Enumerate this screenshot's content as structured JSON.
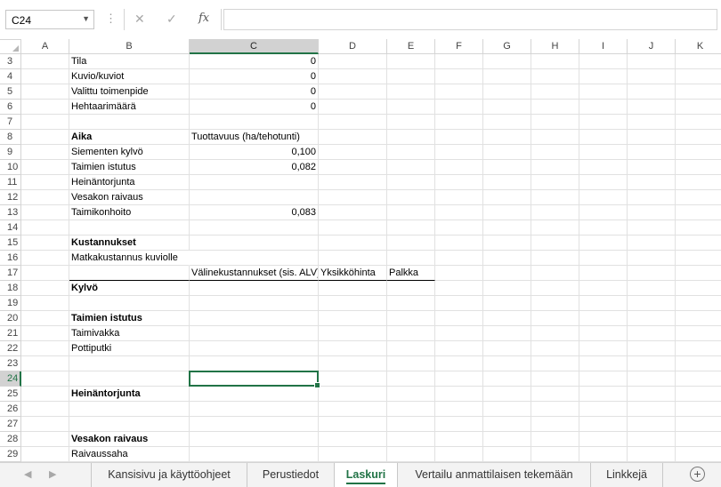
{
  "formula_bar": {
    "name_box": "C24",
    "cancel_icon": "✕",
    "enter_icon": "✓",
    "fx_label": "fx",
    "formula": ""
  },
  "columns": [
    "A",
    "B",
    "C",
    "D",
    "E",
    "F",
    "G",
    "H",
    "I",
    "J",
    "K"
  ],
  "selected_column": "C",
  "selected_row": "24",
  "rows": [
    "3",
    "4",
    "5",
    "6",
    "7",
    "8",
    "9",
    "10",
    "11",
    "12",
    "13",
    "14",
    "15",
    "16",
    "17",
    "18",
    "19",
    "20",
    "21",
    "22",
    "23",
    "24",
    "25",
    "26",
    "27",
    "28",
    "29"
  ],
  "cells": {
    "B3": "Tila",
    "C3": "0",
    "B4": "Kuvio/kuviot",
    "C4": "0",
    "B5": "Valittu toimenpide",
    "C5": "0",
    "B6": "Hehtaarimäärä",
    "C6": "0",
    "B8": "Aika",
    "C8": "Tuottavuus (ha/tehotunti)",
    "B9": "Siementen kylvö",
    "C9": "0,100",
    "B10": "Taimien istutus",
    "C10": "0,082",
    "B11": "Heinäntorjunta",
    "B12": "Vesakon raivaus",
    "B13": "Taimikonhoito",
    "C13": "0,083",
    "B15": "Kustannukset",
    "B16": "Matkakustannus kuviolle",
    "C17": "Välinekustannukset (sis. ALV)",
    "D17": "Yksikköhinta",
    "E17": "Palkka",
    "B18": "Kylvö",
    "B20": "Taimien istutus",
    "B21": "Taimivakka",
    "B22": "Pottiputki",
    "B25": "Heinäntorjunta",
    "B28": "Vesakon raivaus",
    "B29": "Raivaussaha"
  },
  "sheet_tabs": [
    {
      "label": "Kansisivu ja käyttöohjeet",
      "active": false
    },
    {
      "label": "Perustiedot",
      "active": false
    },
    {
      "label": "Laskuri",
      "active": true
    },
    {
      "label": "Vertailu anmattilaisen tekemään",
      "active": false
    },
    {
      "label": "Linkkejä",
      "active": false
    }
  ],
  "colors": {
    "accent": "#217346",
    "header_selected": "#d2d2d2",
    "grid": "#e1e1e1"
  }
}
